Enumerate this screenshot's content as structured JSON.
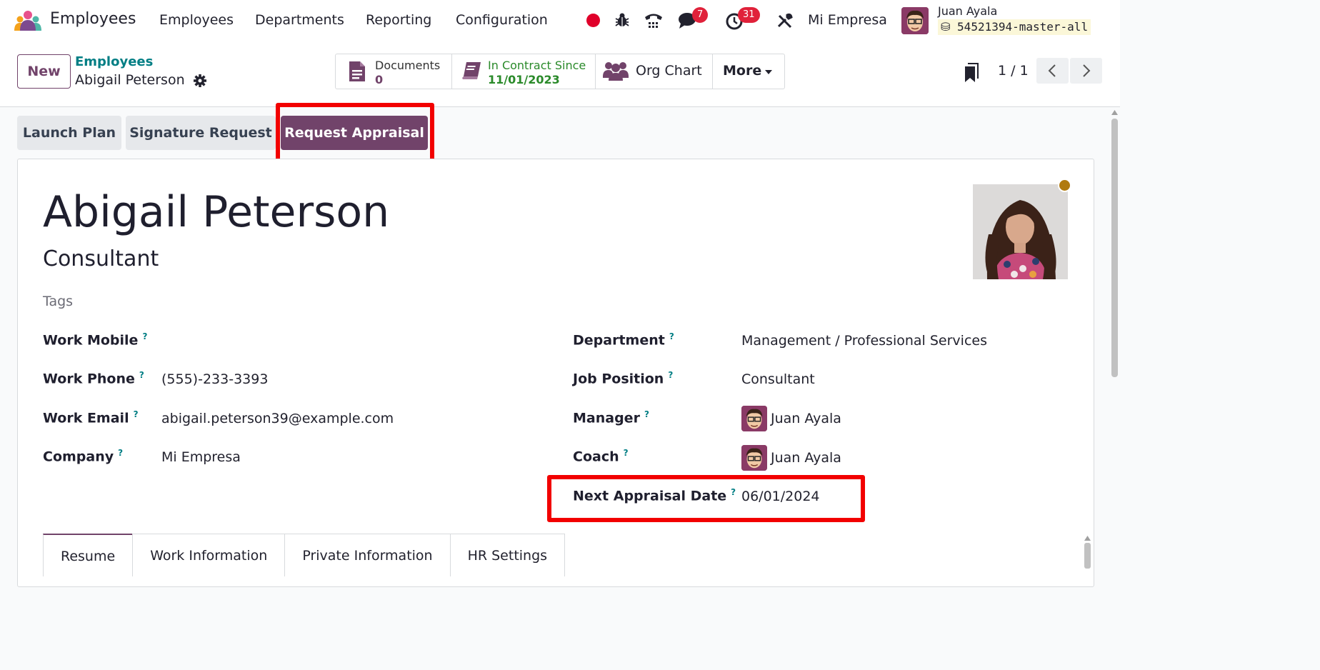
{
  "app": {
    "title": "Employees"
  },
  "menu": {
    "items": [
      {
        "label": "Employees"
      },
      {
        "label": "Departments"
      },
      {
        "label": "Reporting"
      },
      {
        "label": "Configuration"
      }
    ]
  },
  "systray": {
    "messages_count": "7",
    "activities_count": "31",
    "company": "Mi Empresa",
    "user_name": "Juan Ayala",
    "database": "54521394-master-all"
  },
  "control_panel": {
    "new_label": "New",
    "breadcrumb_parent": "Employees",
    "breadcrumb_current": "Abigail Peterson",
    "smart_buttons": {
      "documents_label": "Documents",
      "documents_count": "0",
      "contract_label": "In Contract Since",
      "contract_date": "11/01/2023",
      "org_chart_label": "Org Chart",
      "more_label": "More"
    },
    "pager": {
      "value": "1 / 1"
    }
  },
  "actions": {
    "launch_plan": "Launch Plan",
    "signature_request": "Signature Request",
    "request_appraisal": "Request Appraisal"
  },
  "employee": {
    "name": "Abigail Peterson",
    "job_title": "Consultant",
    "tags_placeholder": "Tags",
    "status_color": "#b07a0e"
  },
  "fields_left": {
    "work_mobile_label": "Work Mobile",
    "work_mobile_value": "",
    "work_phone_label": "Work Phone",
    "work_phone_value": "(555)-233-3393",
    "work_email_label": "Work Email",
    "work_email_value": "abigail.peterson39@example.com",
    "company_label": "Company",
    "company_value": "Mi Empresa"
  },
  "fields_right": {
    "department_label": "Department",
    "department_value": "Management / Professional Services",
    "job_position_label": "Job Position",
    "job_position_value": "Consultant",
    "manager_label": "Manager",
    "manager_value": "Juan Ayala",
    "coach_label": "Coach",
    "coach_value": "Juan Ayala",
    "next_appraisal_label": "Next Appraisal Date",
    "next_appraisal_value": "06/01/2024"
  },
  "help_mark": "?",
  "tabs": [
    {
      "label": "Resume"
    },
    {
      "label": "Work Information"
    },
    {
      "label": "Private Information"
    },
    {
      "label": "HR Settings"
    }
  ],
  "colors": {
    "brand": "#71436a",
    "link": "#017e84",
    "badge": "#e0213a",
    "highlight": "#f20000"
  }
}
